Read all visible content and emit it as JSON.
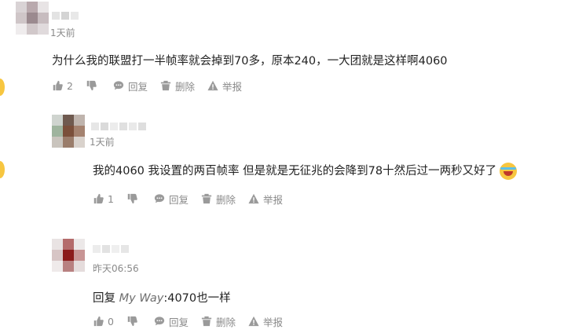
{
  "comments": [
    {
      "time": "1天前",
      "text": "为什么我的联盟打一半帧率就会掉到70多，原本240，一大团就是这样啊4060",
      "like_count": "2",
      "reply_label": "回复",
      "delete_label": "删除",
      "report_label": "举报"
    },
    {
      "time": "1天前",
      "text": "我的4060 我设置的两百帧率 但是就是无征兆的会降到78十然后过一两秒又好了",
      "like_count": "1",
      "reply_label": "回复",
      "delete_label": "删除",
      "report_label": "举报"
    },
    {
      "time": "昨天06:56",
      "reply_prefix": "回复",
      "mention": "My Way",
      "text": ":4070也一样",
      "like_count": "0",
      "reply_label": "回复",
      "delete_label": "删除",
      "report_label": "举报"
    }
  ],
  "icons": {
    "like": "thumb-up-icon",
    "dislike": "thumb-down-icon",
    "reply": "chat-bubble-icon",
    "delete": "trash-icon",
    "report": "warning-icon"
  },
  "colors": {
    "text": "#222222",
    "meta": "#8a8a8a",
    "emoji": "#f7c640"
  }
}
